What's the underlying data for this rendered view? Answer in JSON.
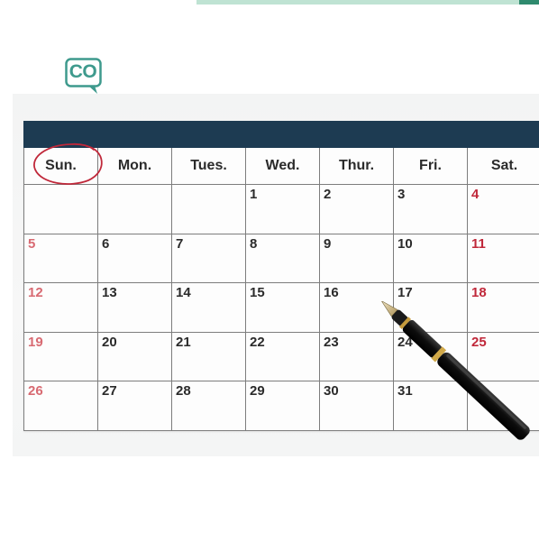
{
  "logo": {
    "text": "CO"
  },
  "calendar": {
    "weekdays": [
      "Sun.",
      "Mon.",
      "Tues.",
      "Wed.",
      "Thur.",
      "Fri.",
      "Sat."
    ],
    "weeks": [
      [
        "",
        "",
        "",
        "1",
        "2",
        "3",
        "4"
      ],
      [
        "5",
        "6",
        "7",
        "8",
        "9",
        "10",
        "11"
      ],
      [
        "12",
        "13",
        "14",
        "15",
        "16",
        "17",
        "18"
      ],
      [
        "19",
        "20",
        "21",
        "22",
        "23",
        "24",
        "25"
      ],
      [
        "26",
        "27",
        "28",
        "29",
        "30",
        "31",
        ""
      ]
    ],
    "circled_day": "Sun."
  },
  "colors": {
    "header_band": "#1d3b52",
    "saturday": "#c0283a",
    "sunday": "#d86a72",
    "circle": "#c0283a",
    "logo": "#3e9a8d"
  },
  "icons": [
    "chat-bubble-logo-icon",
    "fountain-pen-icon"
  ]
}
